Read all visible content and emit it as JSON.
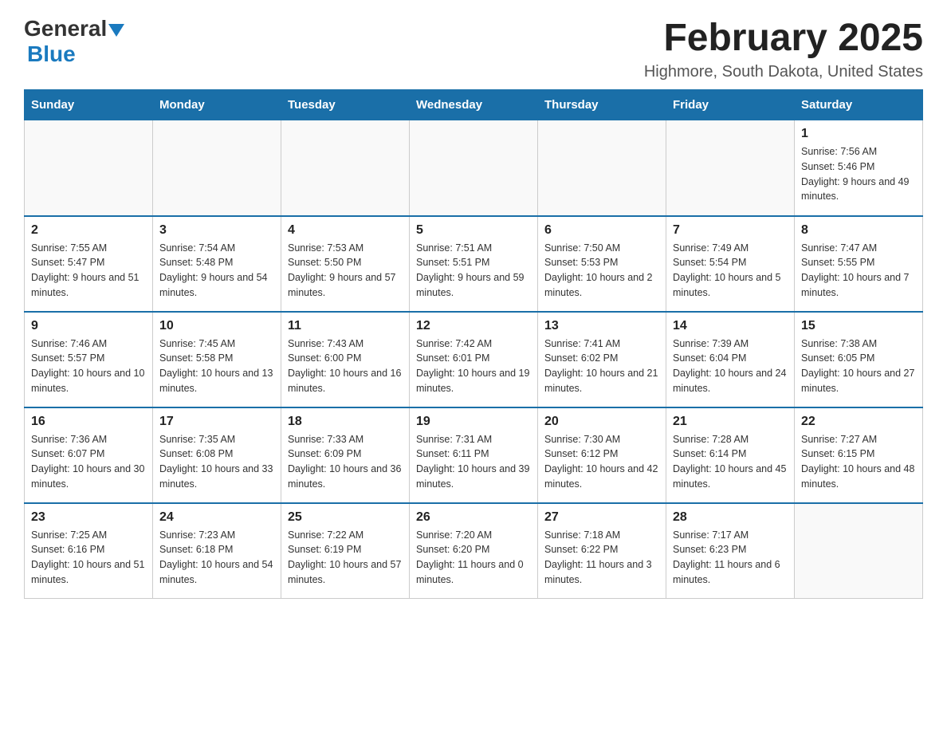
{
  "header": {
    "logo_general": "General",
    "logo_blue": "Blue",
    "month_title": "February 2025",
    "location": "Highmore, South Dakota, United States"
  },
  "days_of_week": [
    "Sunday",
    "Monday",
    "Tuesday",
    "Wednesday",
    "Thursday",
    "Friday",
    "Saturday"
  ],
  "weeks": [
    [
      {
        "day": "",
        "info": ""
      },
      {
        "day": "",
        "info": ""
      },
      {
        "day": "",
        "info": ""
      },
      {
        "day": "",
        "info": ""
      },
      {
        "day": "",
        "info": ""
      },
      {
        "day": "",
        "info": ""
      },
      {
        "day": "1",
        "info": "Sunrise: 7:56 AM\nSunset: 5:46 PM\nDaylight: 9 hours and 49 minutes."
      }
    ],
    [
      {
        "day": "2",
        "info": "Sunrise: 7:55 AM\nSunset: 5:47 PM\nDaylight: 9 hours and 51 minutes."
      },
      {
        "day": "3",
        "info": "Sunrise: 7:54 AM\nSunset: 5:48 PM\nDaylight: 9 hours and 54 minutes."
      },
      {
        "day": "4",
        "info": "Sunrise: 7:53 AM\nSunset: 5:50 PM\nDaylight: 9 hours and 57 minutes."
      },
      {
        "day": "5",
        "info": "Sunrise: 7:51 AM\nSunset: 5:51 PM\nDaylight: 9 hours and 59 minutes."
      },
      {
        "day": "6",
        "info": "Sunrise: 7:50 AM\nSunset: 5:53 PM\nDaylight: 10 hours and 2 minutes."
      },
      {
        "day": "7",
        "info": "Sunrise: 7:49 AM\nSunset: 5:54 PM\nDaylight: 10 hours and 5 minutes."
      },
      {
        "day": "8",
        "info": "Sunrise: 7:47 AM\nSunset: 5:55 PM\nDaylight: 10 hours and 7 minutes."
      }
    ],
    [
      {
        "day": "9",
        "info": "Sunrise: 7:46 AM\nSunset: 5:57 PM\nDaylight: 10 hours and 10 minutes."
      },
      {
        "day": "10",
        "info": "Sunrise: 7:45 AM\nSunset: 5:58 PM\nDaylight: 10 hours and 13 minutes."
      },
      {
        "day": "11",
        "info": "Sunrise: 7:43 AM\nSunset: 6:00 PM\nDaylight: 10 hours and 16 minutes."
      },
      {
        "day": "12",
        "info": "Sunrise: 7:42 AM\nSunset: 6:01 PM\nDaylight: 10 hours and 19 minutes."
      },
      {
        "day": "13",
        "info": "Sunrise: 7:41 AM\nSunset: 6:02 PM\nDaylight: 10 hours and 21 minutes."
      },
      {
        "day": "14",
        "info": "Sunrise: 7:39 AM\nSunset: 6:04 PM\nDaylight: 10 hours and 24 minutes."
      },
      {
        "day": "15",
        "info": "Sunrise: 7:38 AM\nSunset: 6:05 PM\nDaylight: 10 hours and 27 minutes."
      }
    ],
    [
      {
        "day": "16",
        "info": "Sunrise: 7:36 AM\nSunset: 6:07 PM\nDaylight: 10 hours and 30 minutes."
      },
      {
        "day": "17",
        "info": "Sunrise: 7:35 AM\nSunset: 6:08 PM\nDaylight: 10 hours and 33 minutes."
      },
      {
        "day": "18",
        "info": "Sunrise: 7:33 AM\nSunset: 6:09 PM\nDaylight: 10 hours and 36 minutes."
      },
      {
        "day": "19",
        "info": "Sunrise: 7:31 AM\nSunset: 6:11 PM\nDaylight: 10 hours and 39 minutes."
      },
      {
        "day": "20",
        "info": "Sunrise: 7:30 AM\nSunset: 6:12 PM\nDaylight: 10 hours and 42 minutes."
      },
      {
        "day": "21",
        "info": "Sunrise: 7:28 AM\nSunset: 6:14 PM\nDaylight: 10 hours and 45 minutes."
      },
      {
        "day": "22",
        "info": "Sunrise: 7:27 AM\nSunset: 6:15 PM\nDaylight: 10 hours and 48 minutes."
      }
    ],
    [
      {
        "day": "23",
        "info": "Sunrise: 7:25 AM\nSunset: 6:16 PM\nDaylight: 10 hours and 51 minutes."
      },
      {
        "day": "24",
        "info": "Sunrise: 7:23 AM\nSunset: 6:18 PM\nDaylight: 10 hours and 54 minutes."
      },
      {
        "day": "25",
        "info": "Sunrise: 7:22 AM\nSunset: 6:19 PM\nDaylight: 10 hours and 57 minutes."
      },
      {
        "day": "26",
        "info": "Sunrise: 7:20 AM\nSunset: 6:20 PM\nDaylight: 11 hours and 0 minutes."
      },
      {
        "day": "27",
        "info": "Sunrise: 7:18 AM\nSunset: 6:22 PM\nDaylight: 11 hours and 3 minutes."
      },
      {
        "day": "28",
        "info": "Sunrise: 7:17 AM\nSunset: 6:23 PM\nDaylight: 11 hours and 6 minutes."
      },
      {
        "day": "",
        "info": ""
      }
    ]
  ]
}
